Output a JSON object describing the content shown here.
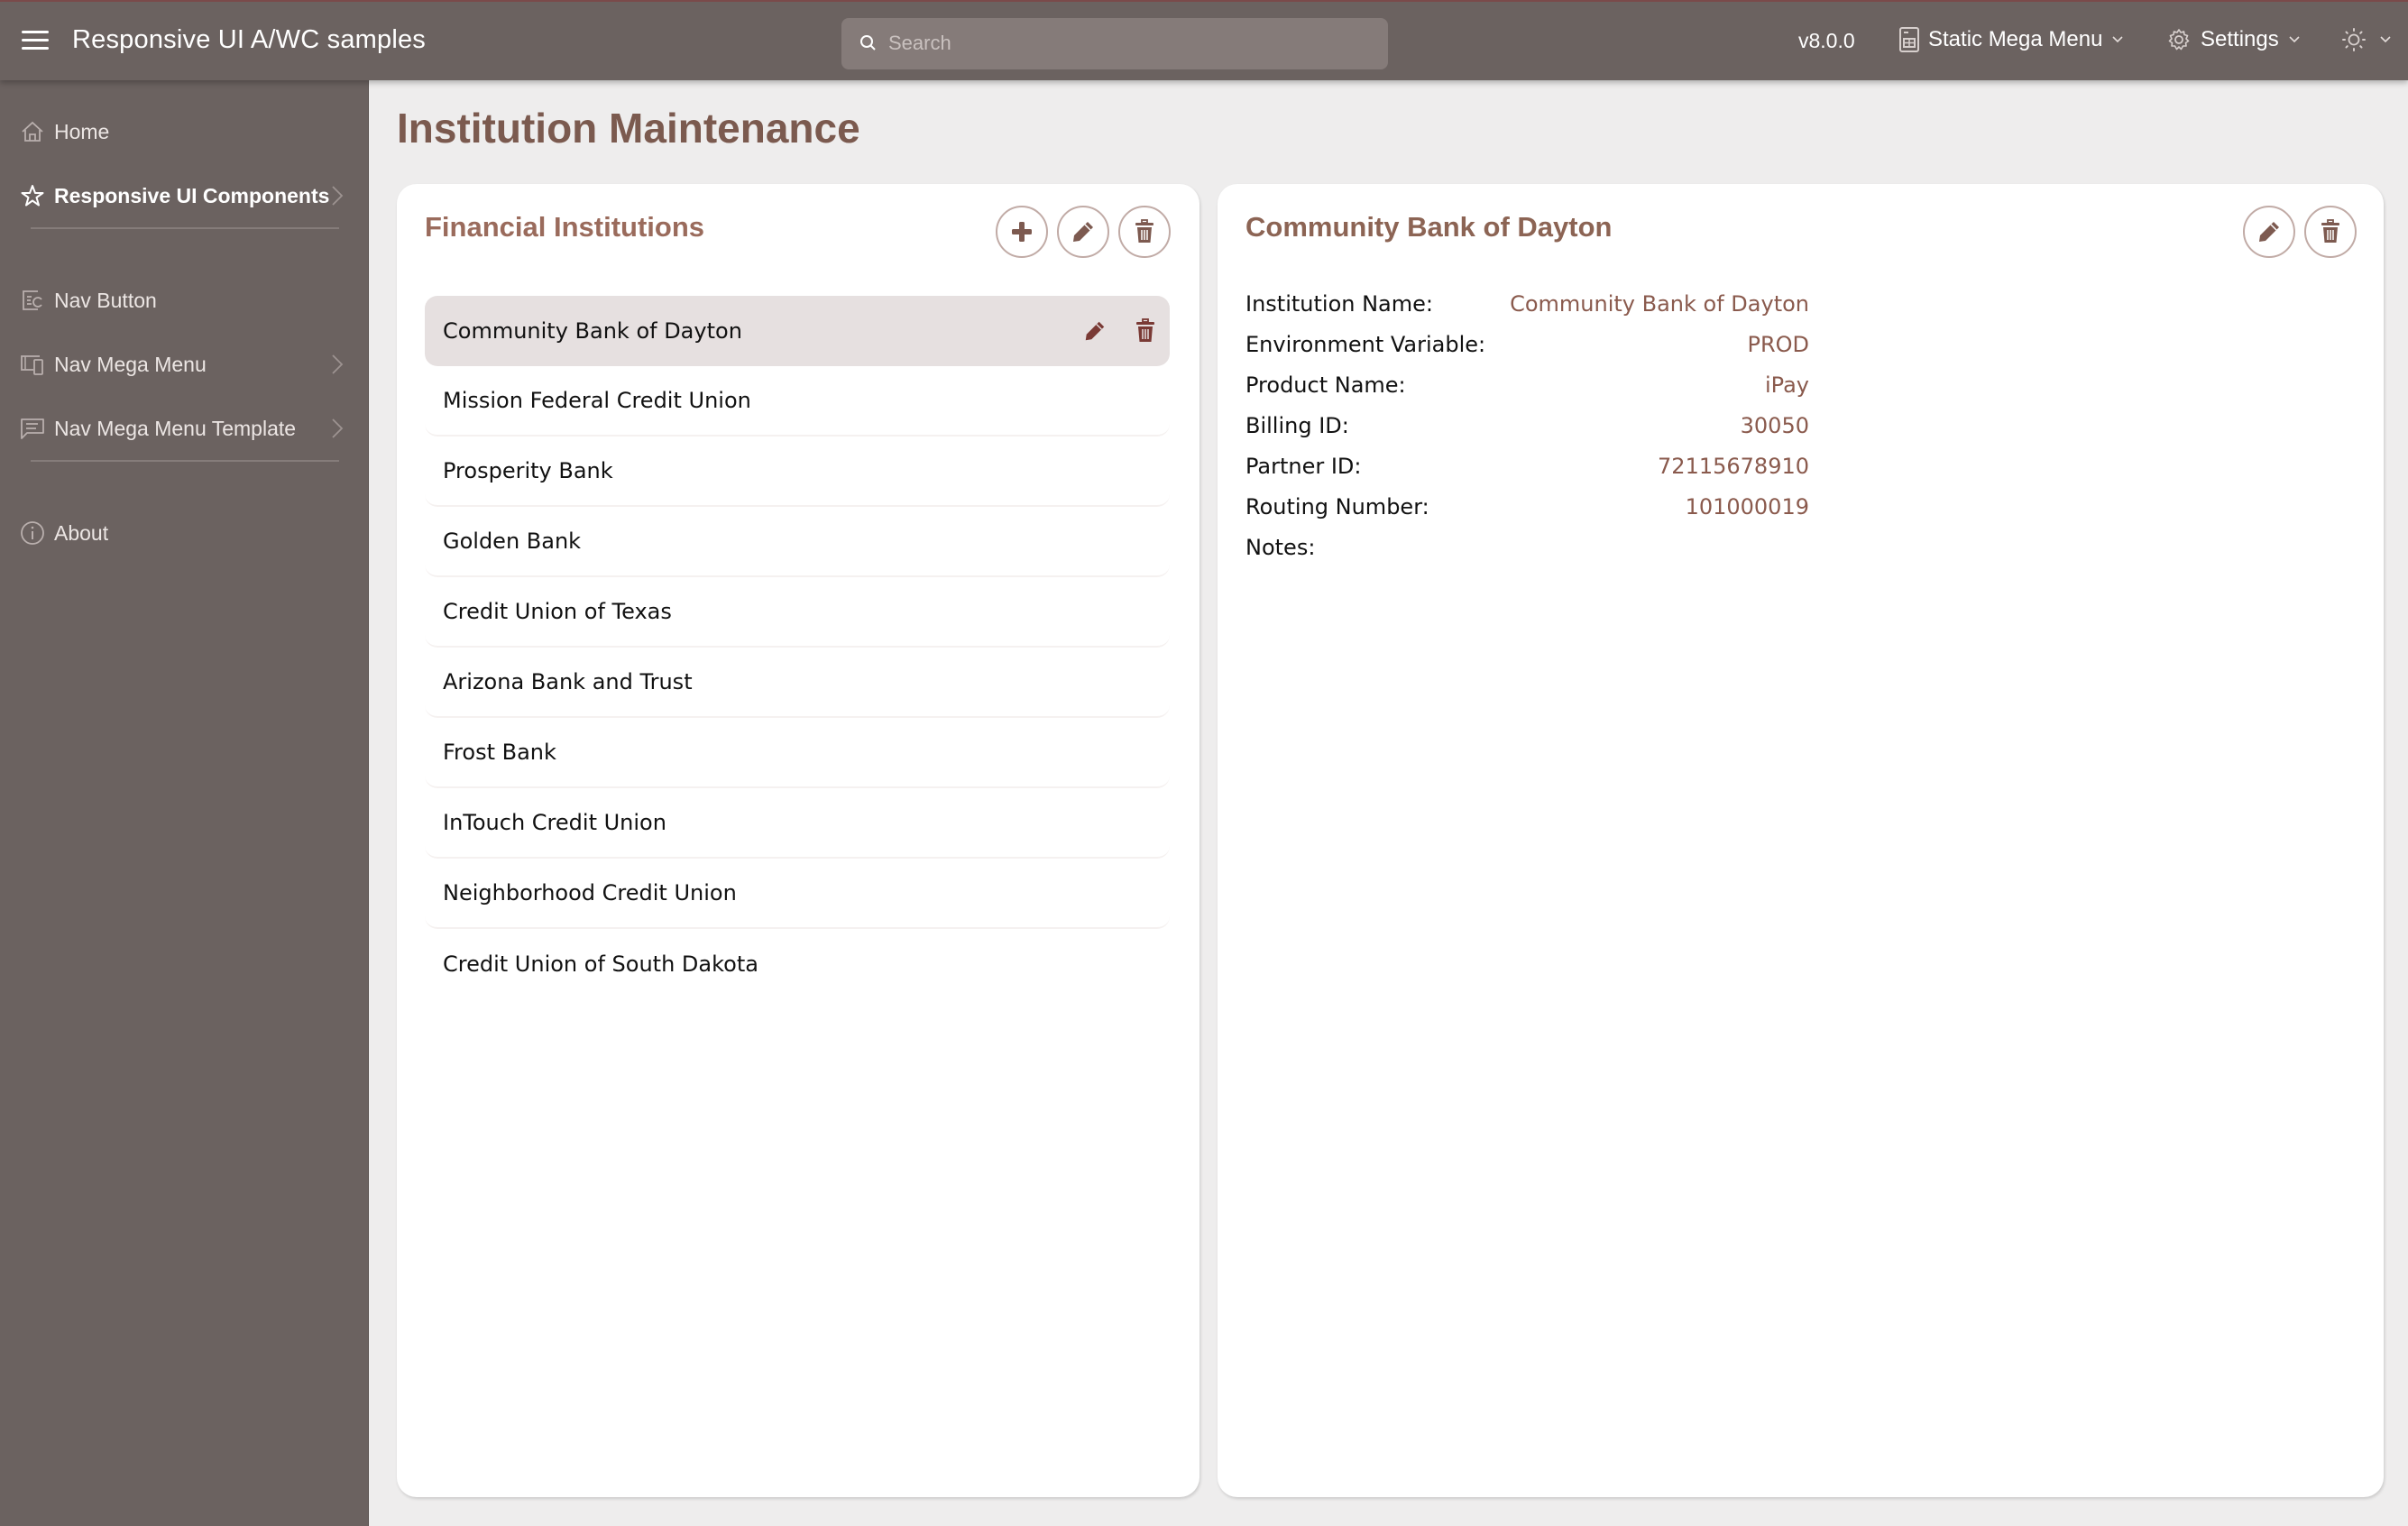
{
  "header": {
    "app_title": "Responsive UI A/WC samples",
    "search_placeholder": "Search",
    "version": "v8.0.0",
    "mega_menu_label": "Static Mega Menu",
    "settings_label": "Settings"
  },
  "sidebar": {
    "items": [
      {
        "label": "Home",
        "icon": "home-icon"
      },
      {
        "label": "Responsive UI Components",
        "icon": "star-icon",
        "active": true,
        "has_submenu": true
      },
      {
        "label": "Nav Button",
        "icon": "nav-button-icon"
      },
      {
        "label": "Nav Mega Menu",
        "icon": "devices-icon",
        "has_submenu": true
      },
      {
        "label": "Nav Mega Menu Template",
        "icon": "chat-icon",
        "has_submenu": true
      },
      {
        "label": "About",
        "icon": "info-icon"
      }
    ]
  },
  "page": {
    "title": "Institution Maintenance"
  },
  "institutions_card": {
    "title": "Financial Institutions",
    "items": [
      "Community Bank of Dayton",
      "Mission Federal Credit Union",
      "Prosperity Bank",
      "Golden Bank",
      "Credit Union of Texas",
      "Arizona Bank and Trust",
      "Frost Bank",
      "InTouch Credit Union",
      "Neighborhood Credit Union",
      "Credit Union of South Dakota"
    ],
    "selected_index": 0
  },
  "detail_card": {
    "title": "Community Bank of Dayton",
    "fields": [
      {
        "label": "Institution Name:",
        "value": "Community Bank of Dayton"
      },
      {
        "label": "Environment Variable:",
        "value": "PROD"
      },
      {
        "label": "Product Name:",
        "value": "iPay"
      },
      {
        "label": "Billing ID:",
        "value": "30050"
      },
      {
        "label": "Partner ID:",
        "value": "72115678910"
      },
      {
        "label": "Routing Number:",
        "value": "101000019"
      },
      {
        "label": "Notes:",
        "value": ""
      }
    ]
  },
  "colors": {
    "header_bg": "#6b6260",
    "accent": "#8a5a4d",
    "selected_row": "#e6e0e0",
    "row_icon": "#7a3a35"
  }
}
